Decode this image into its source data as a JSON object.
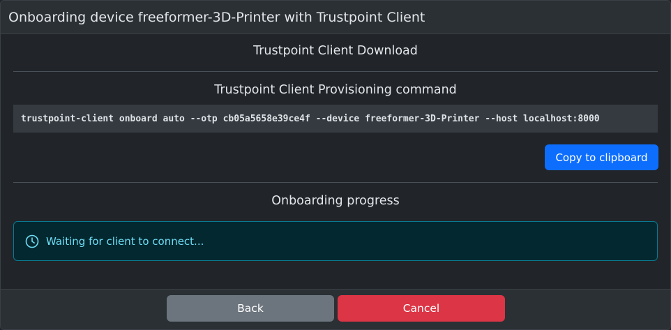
{
  "header": {
    "title": "Onboarding device freeformer-3D-Printer with Trustpoint Client"
  },
  "sections": {
    "download_title": "Trustpoint Client Download",
    "provisioning_title": "Trustpoint Client Provisioning command",
    "progress_title": "Onboarding progress"
  },
  "command": {
    "text": "trustpoint-client onboard auto --otp cb05a5658e39ce4f --device freeformer-3D-Printer --host localhost:8000",
    "copy_label": "Copy to clipboard"
  },
  "status": {
    "icon": "clock-icon",
    "message": "Waiting for client to connect...",
    "color": "#6edff6"
  },
  "footer": {
    "back_label": "Back",
    "cancel_label": "Cancel"
  },
  "colors": {
    "primary": "#0d6efd",
    "secondary": "#6c757d",
    "danger": "#dc3545",
    "info_bg": "#032830",
    "info_border": "#087990"
  }
}
